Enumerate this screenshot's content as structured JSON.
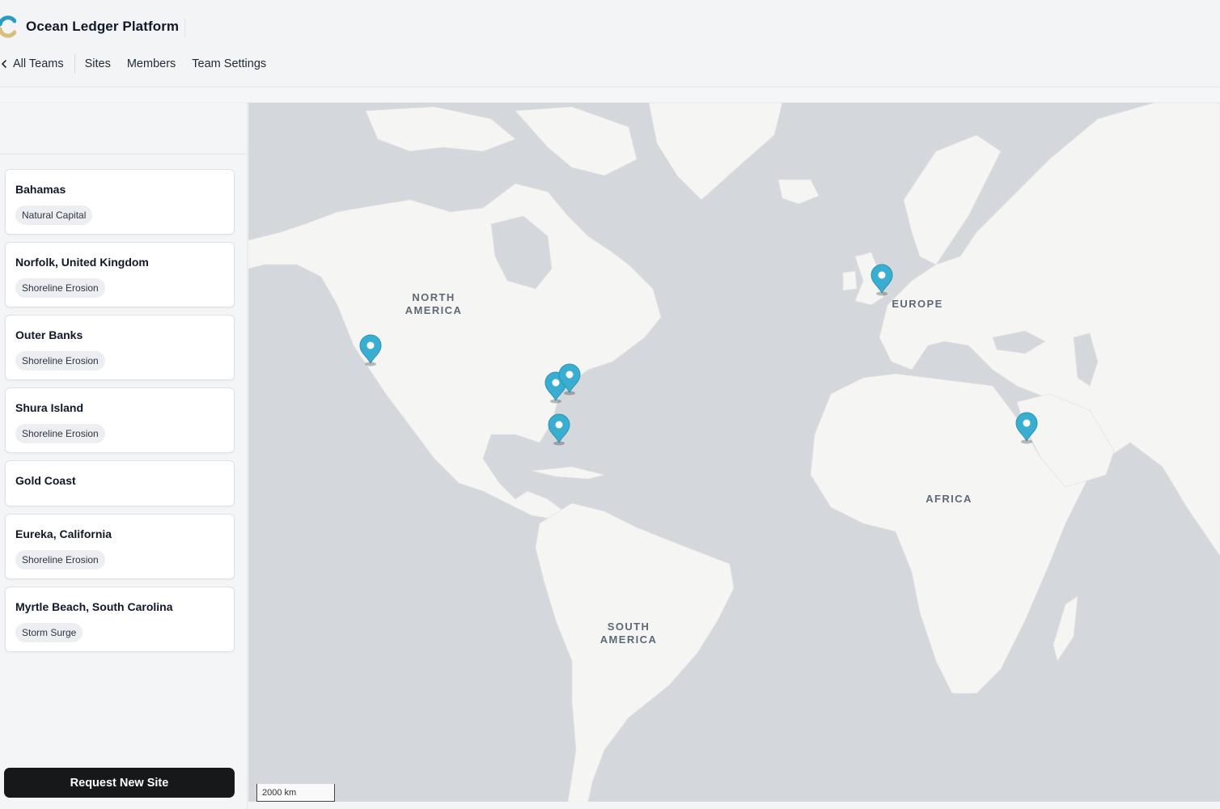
{
  "app": {
    "title": "Ocean Ledger Platform"
  },
  "nav": {
    "back_label": "All Teams",
    "items": [
      "Sites",
      "Members",
      "Team Settings"
    ]
  },
  "sites": [
    {
      "name": "Bahamas",
      "tag": "Natural Capital"
    },
    {
      "name": "Norfolk, United Kingdom",
      "tag": "Shoreline Erosion"
    },
    {
      "name": "Outer Banks",
      "tag": "Shoreline Erosion"
    },
    {
      "name": "Shura Island",
      "tag": "Shoreline Erosion"
    },
    {
      "name": "Gold Coast",
      "tag": ""
    },
    {
      "name": "Eureka, California",
      "tag": "Shoreline Erosion"
    },
    {
      "name": "Myrtle Beach, South Carolina",
      "tag": "Storm Surge"
    }
  ],
  "request_button": "Request New Site",
  "map": {
    "labels": {
      "north_america": [
        "NORTH",
        "AMERICA"
      ],
      "south_america": [
        "SOUTH",
        "AMERICA"
      ],
      "europe": "EUROPE",
      "africa": "AFRICA"
    },
    "scale": "2000 km",
    "marker_color": "#3aaed0",
    "land_color": "#f5f5f4",
    "water_color": "#d4d8dc"
  }
}
